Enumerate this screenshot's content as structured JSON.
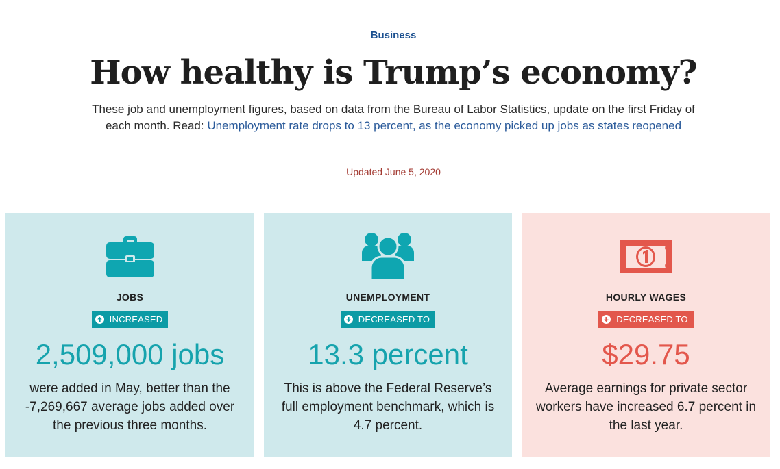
{
  "header": {
    "kicker": "Business",
    "title": "How healthy is Trump’s economy?",
    "intro_text": "These job and unemployment figures, based on data from the Bureau of Labor Statistics, update on the first Friday of each month. Read: ",
    "intro_link": "Unemployment rate drops to 13 percent, as the economy picked up jobs as states reopened",
    "updated": "Updated June 5, 2020"
  },
  "cards": [
    {
      "icon": "briefcase-icon",
      "label": "JOBS",
      "badge": "INCREASED",
      "badge_direction": "up",
      "value": "2,509,000 jobs",
      "description": "were added in May, better than the -7,269,667 average jobs added over the previous three months."
    },
    {
      "icon": "people-group-icon",
      "label": "UNEMPLOYMENT",
      "badge": "DECREASED TO",
      "badge_direction": "down",
      "value": "13.3 percent",
      "description": "This is above the Federal Reserve’s full employment benchmark, which is 4.7 percent."
    },
    {
      "icon": "dollar-bill-icon",
      "label": "HOURLY WAGES",
      "badge": "DECREASED TO",
      "badge_direction": "down",
      "value": "$29.75",
      "description": "Average earnings for private sector workers have increased 6.7 percent in the last year."
    }
  ],
  "colors": {
    "kicker": "#1a4f8f",
    "link": "#2a5a9a",
    "updated": "#a33a32",
    "teal_card_bg": "#cfe9ec",
    "pink_card_bg": "#fbe1de",
    "teal_accent": "#0c9ba5",
    "red_accent": "#e2574c"
  }
}
